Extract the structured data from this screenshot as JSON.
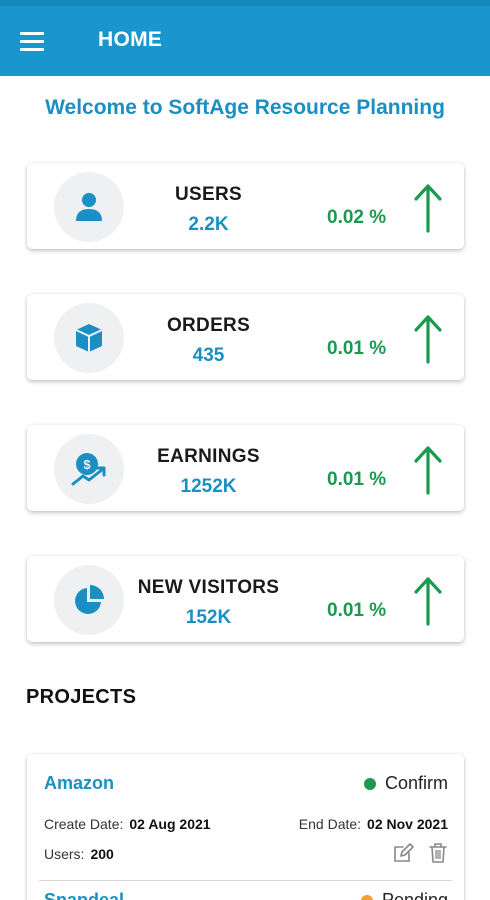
{
  "appbar": {
    "title": "HOME"
  },
  "welcome": "Welcome to SoftAge Resource Planning",
  "stats": [
    {
      "label": "USERS",
      "value": "2.2K",
      "change": "0.02 %",
      "icon": "user-icon",
      "trend": "up"
    },
    {
      "label": "ORDERS",
      "value": "435",
      "change": "0.01 %",
      "icon": "box-icon",
      "trend": "up"
    },
    {
      "label": "EARNINGS",
      "value": "1252K",
      "change": "0.01 %",
      "icon": "earnings-icon",
      "trend": "up"
    },
    {
      "label": "NEW VISITORS",
      "value": "152K",
      "change": "0.01 %",
      "icon": "pie-chart-icon",
      "trend": "up"
    }
  ],
  "colors": {
    "primary": "#1a96cf",
    "accent_text": "#1b8fc4",
    "positive": "#1a9a4e",
    "pending": "#f0a030"
  },
  "projects_title": "PROJECTS",
  "projects": [
    {
      "name": "Amazon",
      "status": "Confirm",
      "create_label": "Create Date:",
      "create_date": "02 Aug 2021",
      "end_label": "End Date:",
      "end_date": "02 Nov 2021",
      "users_label": "Users:",
      "users": "200"
    },
    {
      "name": "Snapdeal",
      "status": "Pending"
    }
  ]
}
